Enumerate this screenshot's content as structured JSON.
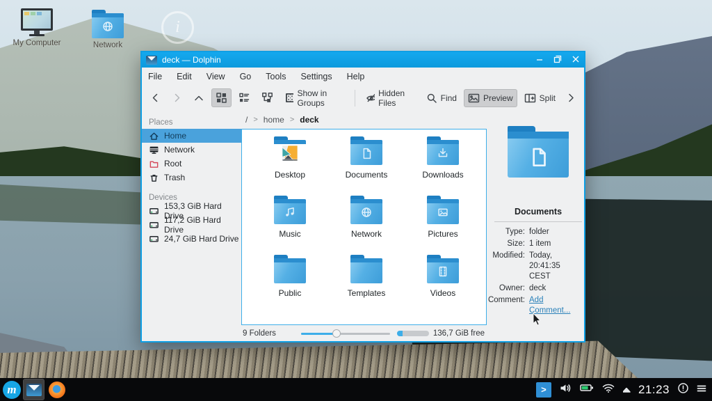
{
  "colors": {
    "accent": "#3daee9",
    "titlebar_blue": "#0fa3e9",
    "window_bg": "#eff0f1",
    "selection": "#4aa2dc"
  },
  "desktop": {
    "icons": [
      {
        "label": "My Computer"
      },
      {
        "label": "Network"
      }
    ],
    "ghost_glyph": "i"
  },
  "window": {
    "title": "deck — Dolphin",
    "menu": [
      "File",
      "Edit",
      "View",
      "Go",
      "Tools",
      "Settings",
      "Help"
    ],
    "toolbar": {
      "show_in_groups": "Show in Groups",
      "hidden_files": "Hidden Files",
      "find": "Find",
      "preview": "Preview",
      "split": "Split"
    },
    "sidebar": {
      "places_header": "Places",
      "places": [
        "Home",
        "Network",
        "Root",
        "Trash"
      ],
      "devices_header": "Devices",
      "devices": [
        "153,3 GiB Hard Drive",
        "117,2 GiB Hard Drive",
        "24,7 GiB Hard Drive"
      ]
    },
    "breadcrumb": {
      "root": "/",
      "sep": ">",
      "parent": "home",
      "current": "deck"
    },
    "folders": [
      "Desktop",
      "Documents",
      "Downloads",
      "Music",
      "Network",
      "Pictures",
      "Public",
      "Templates",
      "Videos"
    ],
    "info": {
      "title": "Documents",
      "type_label": "Type:",
      "type": "folder",
      "size_label": "Size:",
      "size": "1 item",
      "modified_label": "Modified:",
      "modified": "Today, 20:41:35 CEST",
      "owner_label": "Owner:",
      "owner": "deck",
      "comment_label": "Comment:",
      "comment_link": "Add Comment..."
    },
    "status": {
      "items": "9 Folders",
      "free": "136,7 GiB free"
    }
  },
  "taskbar": {
    "launcher_glyph": "m",
    "tray_arrow_glyph": ">",
    "clock": "21:23"
  }
}
